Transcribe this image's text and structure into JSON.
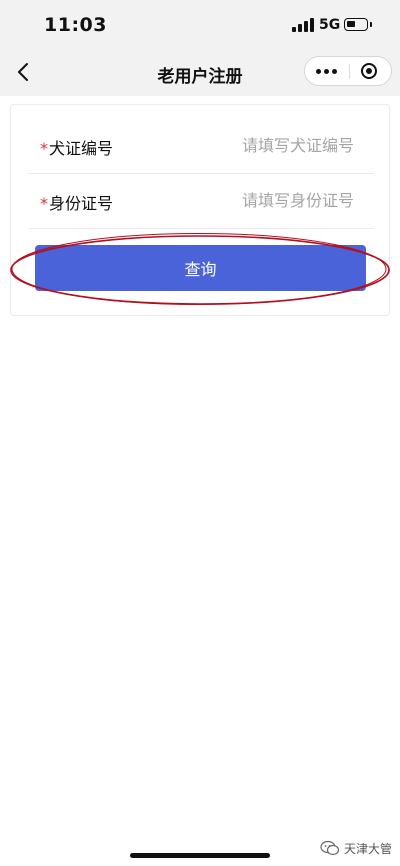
{
  "status_bar": {
    "time": "11:03",
    "network": "5G",
    "battery_level": 0.45,
    "icons": [
      "signal-icon",
      "battery-icon"
    ]
  },
  "nav": {
    "title": "老用户注册",
    "icons": [
      "back-icon",
      "more-icon",
      "close-mini-program-icon"
    ]
  },
  "form": {
    "required_marker": "*",
    "fields": [
      {
        "label": "犬证编号",
        "value": "",
        "placeholder": "请填写犬证编号"
      },
      {
        "label": "身份证号",
        "value": "",
        "placeholder": "请填写身份证号"
      }
    ],
    "submit_label": "查询"
  },
  "annotation": {
    "color": "#b3101e",
    "shape": "ellipse around submit button"
  },
  "colors": {
    "accent": "#4b63d8",
    "required": "#d9363e",
    "nav_background": "#f2f2f2"
  },
  "watermark": {
    "text": "天津大管",
    "icon": "wechat-icon"
  }
}
